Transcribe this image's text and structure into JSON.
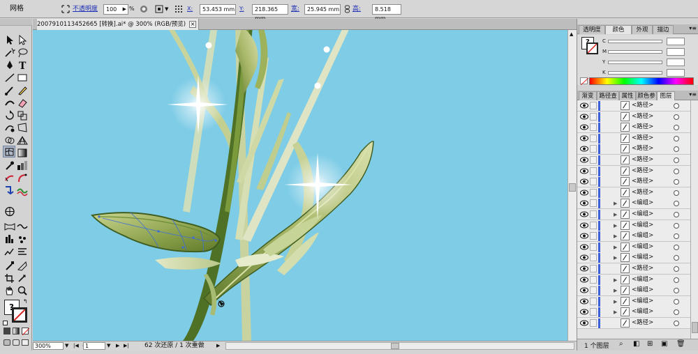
{
  "control_bar": {
    "panel_label": "网格",
    "opacity_label": "不透明度",
    "opacity_value": "100",
    "opacity_unit": "%",
    "x_label": "X:",
    "x_value": "53.453 mm",
    "y_label": "Y:",
    "y_value": "218.365 mm",
    "w_label": "宽:",
    "w_value": "25.945 mm",
    "h_label": "高:",
    "h_value": "8.518 mm"
  },
  "document": {
    "tab_title": "20079101134526​65 [转换].ai* @ 300% (RGB/预览)",
    "close": "×"
  },
  "status_bar": {
    "zoom": "300%",
    "page": "1",
    "message": "62 次还原 / 1 次重做"
  },
  "color_panel": {
    "tabs": [
      "透明度",
      "颜色",
      "外观",
      "描边"
    ],
    "active_tab": "颜色",
    "channels": [
      "C",
      "M",
      "Y",
      "K"
    ]
  },
  "layers_panel": {
    "tabs": [
      "渐变",
      "路径查",
      "属性",
      "颜色参",
      "图层"
    ],
    "active_tab": "图层",
    "rows": [
      {
        "label": "<路径>",
        "expand": ""
      },
      {
        "label": "<路径>",
        "expand": ""
      },
      {
        "label": "<路径>",
        "expand": ""
      },
      {
        "label": "<路径>",
        "expand": ""
      },
      {
        "label": "<路径>",
        "expand": ""
      },
      {
        "label": "<路径>",
        "expand": ""
      },
      {
        "label": "<路径>",
        "expand": ""
      },
      {
        "label": "<路径>",
        "expand": ""
      },
      {
        "label": "<路径>",
        "expand": ""
      },
      {
        "label": "<编组>",
        "expand": "▶"
      },
      {
        "label": "<编组>",
        "expand": "▶"
      },
      {
        "label": "<编组>",
        "expand": "▶"
      },
      {
        "label": "<编组>",
        "expand": "▶"
      },
      {
        "label": "<编组>",
        "expand": "▶"
      },
      {
        "label": "<编组>",
        "expand": "▶"
      },
      {
        "label": "<路径>",
        "expand": ""
      },
      {
        "label": "<编组>",
        "expand": "▶"
      },
      {
        "label": "<编组>",
        "expand": "▶"
      },
      {
        "label": "<编组>",
        "expand": "▶"
      },
      {
        "label": "<编组>",
        "expand": "▶"
      },
      {
        "label": "<路径>",
        "expand": ""
      }
    ],
    "footer_count": "1 个图层"
  }
}
